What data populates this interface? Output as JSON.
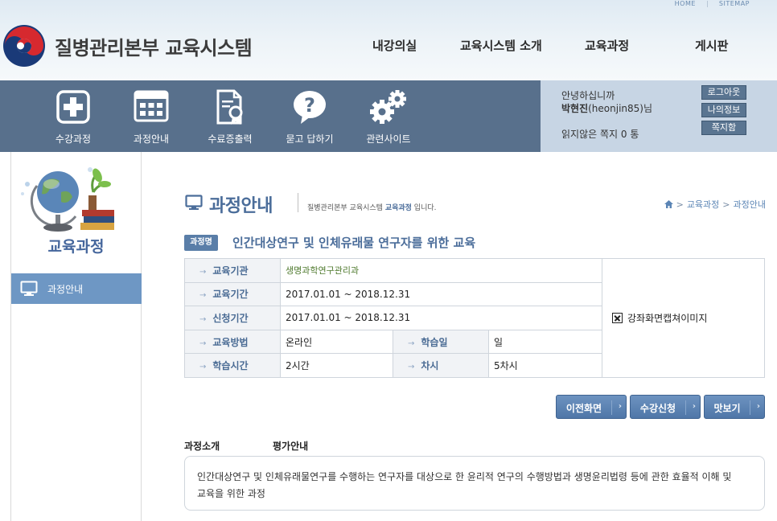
{
  "header": {
    "util_links": [
      "HOME",
      "SITEMAP"
    ],
    "site_title": "질병관리본부 교육시스템",
    "gnb": [
      "내강의실",
      "교육시스템 소개",
      "교육과정",
      "게시판"
    ]
  },
  "band": {
    "items": [
      {
        "label": "수강과정",
        "icon": "plus-box-icon"
      },
      {
        "label": "과정안내",
        "icon": "calendar-icon"
      },
      {
        "label": "수료증출력",
        "icon": "certificate-icon"
      },
      {
        "label": "묻고 답하기",
        "icon": "question-bubble-icon"
      },
      {
        "label": "관련사이트",
        "icon": "gears-icon"
      }
    ]
  },
  "user": {
    "greeting": "안녕하십니까",
    "name": "박현진",
    "id": "(heonjin85)",
    "suffix": "님",
    "unread": "읽지않은 쪽지 0 통",
    "buttons": [
      "로그아웃",
      "나의정보",
      "쪽지함"
    ]
  },
  "sidebar": {
    "title": "교육과정",
    "menu": [
      "과정안내"
    ]
  },
  "page": {
    "title": "과정안내",
    "desc_pre": "질병관리본부 교육시스템 ",
    "desc_em": "교육과정",
    "desc_post": " 입니다.",
    "breadcrumb": [
      "교육과정",
      "과정안내"
    ]
  },
  "course": {
    "badge": "과정명",
    "name": "인간대상연구 및 인체유래물 연구자를 위한 교육",
    "rows": {
      "org_label": "교육기관",
      "org_value": "생명과학연구관리과",
      "period_label": "교육기간",
      "period_value": "2017.01.01 ~ 2018.12.31",
      "apply_label": "신청기간",
      "apply_value": "2017.01.01 ~ 2018.12.31",
      "method_label": "교육방법",
      "method_value": "온라인",
      "days_label": "학습일",
      "days_value": "일",
      "hours_label": "학습시간",
      "hours_value": "2시간",
      "sessions_label": "차시",
      "sessions_value": "5차시"
    },
    "image_alt": "강좌화면캡쳐이미지"
  },
  "actions": [
    "이전화면",
    "수강신청",
    "맛보기"
  ],
  "tabs": [
    "과정소개",
    "평가안내"
  ],
  "intro": "인간대상연구 및 인체유래물연구를 수행하는 연구자를 대상으로 한 윤리적 연구의 수행방법과 생명윤리법령 등에 관한 효율적 이해 및 교육을 위한 과정",
  "colors": {
    "band": "#58708c",
    "accent": "#4b6d9a",
    "button": "#4f77a8"
  }
}
